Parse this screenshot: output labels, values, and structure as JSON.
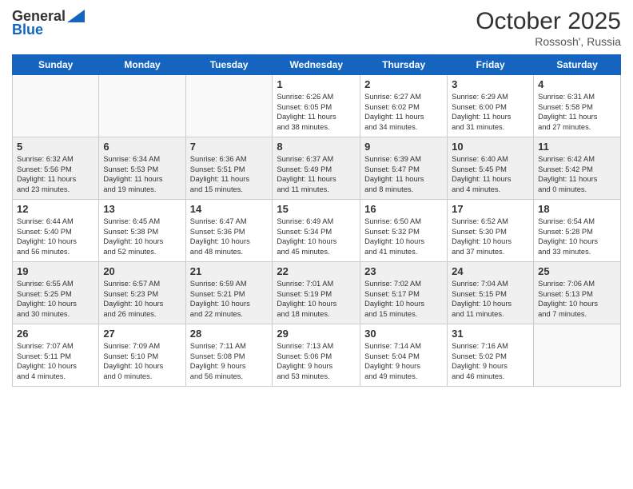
{
  "header": {
    "logo_line1": "General",
    "logo_line2": "Blue",
    "month": "October 2025",
    "location": "Rossosh', Russia"
  },
  "weekdays": [
    "Sunday",
    "Monday",
    "Tuesday",
    "Wednesday",
    "Thursday",
    "Friday",
    "Saturday"
  ],
  "weeks": [
    [
      {
        "day": "",
        "info": ""
      },
      {
        "day": "",
        "info": ""
      },
      {
        "day": "",
        "info": ""
      },
      {
        "day": "1",
        "info": "Sunrise: 6:26 AM\nSunset: 6:05 PM\nDaylight: 11 hours\nand 38 minutes."
      },
      {
        "day": "2",
        "info": "Sunrise: 6:27 AM\nSunset: 6:02 PM\nDaylight: 11 hours\nand 34 minutes."
      },
      {
        "day": "3",
        "info": "Sunrise: 6:29 AM\nSunset: 6:00 PM\nDaylight: 11 hours\nand 31 minutes."
      },
      {
        "day": "4",
        "info": "Sunrise: 6:31 AM\nSunset: 5:58 PM\nDaylight: 11 hours\nand 27 minutes."
      }
    ],
    [
      {
        "day": "5",
        "info": "Sunrise: 6:32 AM\nSunset: 5:56 PM\nDaylight: 11 hours\nand 23 minutes."
      },
      {
        "day": "6",
        "info": "Sunrise: 6:34 AM\nSunset: 5:53 PM\nDaylight: 11 hours\nand 19 minutes."
      },
      {
        "day": "7",
        "info": "Sunrise: 6:36 AM\nSunset: 5:51 PM\nDaylight: 11 hours\nand 15 minutes."
      },
      {
        "day": "8",
        "info": "Sunrise: 6:37 AM\nSunset: 5:49 PM\nDaylight: 11 hours\nand 11 minutes."
      },
      {
        "day": "9",
        "info": "Sunrise: 6:39 AM\nSunset: 5:47 PM\nDaylight: 11 hours\nand 8 minutes."
      },
      {
        "day": "10",
        "info": "Sunrise: 6:40 AM\nSunset: 5:45 PM\nDaylight: 11 hours\nand 4 minutes."
      },
      {
        "day": "11",
        "info": "Sunrise: 6:42 AM\nSunset: 5:42 PM\nDaylight: 11 hours\nand 0 minutes."
      }
    ],
    [
      {
        "day": "12",
        "info": "Sunrise: 6:44 AM\nSunset: 5:40 PM\nDaylight: 10 hours\nand 56 minutes."
      },
      {
        "day": "13",
        "info": "Sunrise: 6:45 AM\nSunset: 5:38 PM\nDaylight: 10 hours\nand 52 minutes."
      },
      {
        "day": "14",
        "info": "Sunrise: 6:47 AM\nSunset: 5:36 PM\nDaylight: 10 hours\nand 48 minutes."
      },
      {
        "day": "15",
        "info": "Sunrise: 6:49 AM\nSunset: 5:34 PM\nDaylight: 10 hours\nand 45 minutes."
      },
      {
        "day": "16",
        "info": "Sunrise: 6:50 AM\nSunset: 5:32 PM\nDaylight: 10 hours\nand 41 minutes."
      },
      {
        "day": "17",
        "info": "Sunrise: 6:52 AM\nSunset: 5:30 PM\nDaylight: 10 hours\nand 37 minutes."
      },
      {
        "day": "18",
        "info": "Sunrise: 6:54 AM\nSunset: 5:28 PM\nDaylight: 10 hours\nand 33 minutes."
      }
    ],
    [
      {
        "day": "19",
        "info": "Sunrise: 6:55 AM\nSunset: 5:25 PM\nDaylight: 10 hours\nand 30 minutes."
      },
      {
        "day": "20",
        "info": "Sunrise: 6:57 AM\nSunset: 5:23 PM\nDaylight: 10 hours\nand 26 minutes."
      },
      {
        "day": "21",
        "info": "Sunrise: 6:59 AM\nSunset: 5:21 PM\nDaylight: 10 hours\nand 22 minutes."
      },
      {
        "day": "22",
        "info": "Sunrise: 7:01 AM\nSunset: 5:19 PM\nDaylight: 10 hours\nand 18 minutes."
      },
      {
        "day": "23",
        "info": "Sunrise: 7:02 AM\nSunset: 5:17 PM\nDaylight: 10 hours\nand 15 minutes."
      },
      {
        "day": "24",
        "info": "Sunrise: 7:04 AM\nSunset: 5:15 PM\nDaylight: 10 hours\nand 11 minutes."
      },
      {
        "day": "25",
        "info": "Sunrise: 7:06 AM\nSunset: 5:13 PM\nDaylight: 10 hours\nand 7 minutes."
      }
    ],
    [
      {
        "day": "26",
        "info": "Sunrise: 7:07 AM\nSunset: 5:11 PM\nDaylight: 10 hours\nand 4 minutes."
      },
      {
        "day": "27",
        "info": "Sunrise: 7:09 AM\nSunset: 5:10 PM\nDaylight: 10 hours\nand 0 minutes."
      },
      {
        "day": "28",
        "info": "Sunrise: 7:11 AM\nSunset: 5:08 PM\nDaylight: 9 hours\nand 56 minutes."
      },
      {
        "day": "29",
        "info": "Sunrise: 7:13 AM\nSunset: 5:06 PM\nDaylight: 9 hours\nand 53 minutes."
      },
      {
        "day": "30",
        "info": "Sunrise: 7:14 AM\nSunset: 5:04 PM\nDaylight: 9 hours\nand 49 minutes."
      },
      {
        "day": "31",
        "info": "Sunrise: 7:16 AM\nSunset: 5:02 PM\nDaylight: 9 hours\nand 46 minutes."
      },
      {
        "day": "",
        "info": ""
      }
    ]
  ]
}
